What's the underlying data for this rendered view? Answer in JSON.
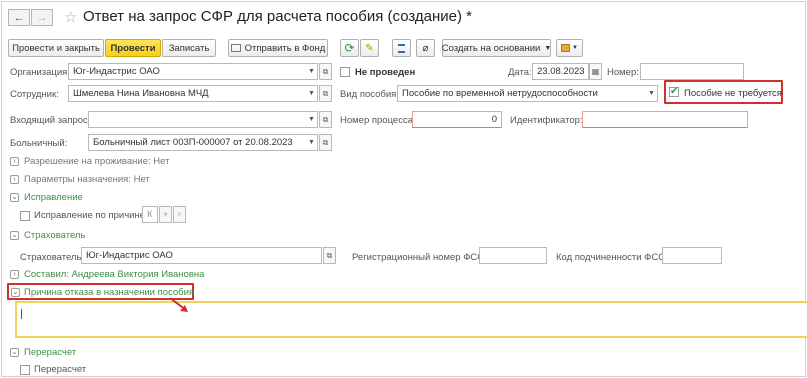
{
  "nav": {
    "back": "←",
    "forward": "→"
  },
  "title": "Ответ на запрос СФР для расчета пособия (создание) *",
  "toolbar": {
    "post_close": "Провести и закрыть",
    "post": "Провести",
    "save": "Записать",
    "send_fund": "Отправить в Фонд",
    "create_based": "Создать на основании"
  },
  "form": {
    "org_label": "Организация:",
    "org_value": "Юг-Индастрис ОАО",
    "status": "Не проведен",
    "date_label": "Дата:",
    "date_value": "23.08.2023",
    "number_label": "Номер:",
    "number_value": "",
    "employee_label": "Сотрудник:",
    "employee_value": "Шмелева Нина Ивановна МЧД",
    "benefit_label": "Вид пособия:",
    "benefit_value": "Пособие по временной нетрудоспособности",
    "no_benefit_label": "Пособие не требуется",
    "incoming_label": "Входящий запрос:",
    "incoming_value": "",
    "process_label": "Номер процесса:",
    "process_value": "0",
    "identifier_label": "Идентификатор:",
    "identifier_value": "",
    "sick_label": "Больничный:",
    "sick_value": "Больничный лист 003П-000007 от 20.08.2023"
  },
  "groups": {
    "residence": "Разрешение на проживание: Нет",
    "params": "Параметры назначения: Нет",
    "correction": "Исправление",
    "correction_by_reason": "Исправление по причине:",
    "correction_reason_value": "К",
    "insurer": "Страхователь",
    "insurer_label": "Страхователь:",
    "insurer_value": "Юг-Индастрис ОАО",
    "reg_fss_label": "Регистрационный номер ФСС:",
    "reg_fss_value": "",
    "sub_fss_label": "Код подчиненности ФСС:",
    "sub_fss_value": "",
    "compiled": "Составил: Андреева Виктория Ивановна",
    "refusal": "Причина отказа в назначении пособия",
    "refusal_text": "",
    "recalc": "Перерасчет",
    "recalc_check": "Перерасчет"
  },
  "colors": {
    "accent_yellow": "#f7cf16",
    "group_green": "#3c8f4b",
    "highlight_red": "#d0302c",
    "refusal_border": "#f0d458"
  }
}
